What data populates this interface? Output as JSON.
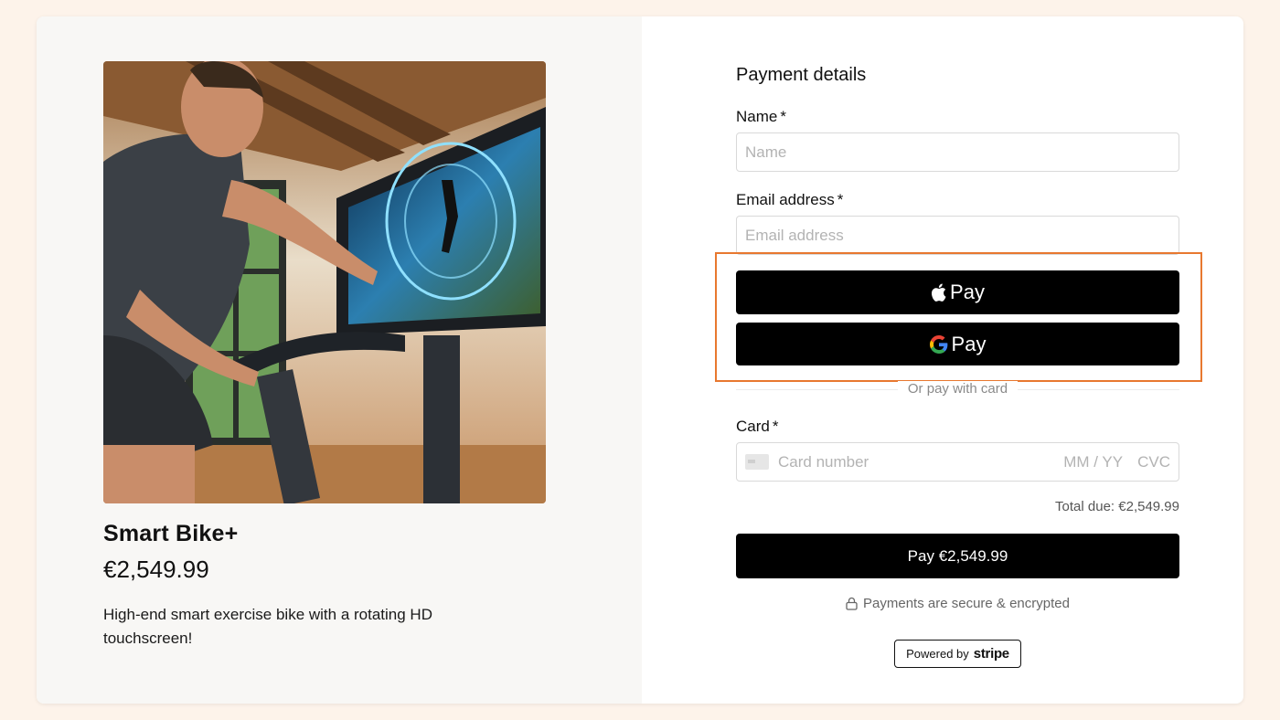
{
  "product": {
    "image_alt": "Man riding a smart exercise bike with a large touchscreen",
    "name": "Smart Bike+",
    "price": "€2,549.99",
    "description": "High-end smart exercise bike with a rotating HD touchscreen!"
  },
  "payment": {
    "title": "Payment details",
    "name_label": "Name",
    "name_placeholder": "Name",
    "email_label": "Email address",
    "email_placeholder": "Email address",
    "required_mark": "*",
    "apple_pay_label": "Pay",
    "google_pay_label": "Pay",
    "divider_text": "Or pay with card",
    "card_label": "Card",
    "card_number_placeholder": "Card number",
    "card_expiry_placeholder": "MM / YY",
    "card_cvc_placeholder": "CVC",
    "total_due": "Total due: €2,549.99",
    "pay_button_label": "Pay €2,549.99",
    "secure_text": "Payments are secure & encrypted",
    "powered_by": "Powered by",
    "powered_brand": "stripe"
  },
  "colors": {
    "page_background": "#fdf3ea",
    "highlight_outline": "#e8782f",
    "button_black": "#000000"
  },
  "icons": {
    "apple": "apple-icon",
    "google": "google-icon",
    "lock": "lock-icon",
    "card": "credit-card-icon"
  }
}
